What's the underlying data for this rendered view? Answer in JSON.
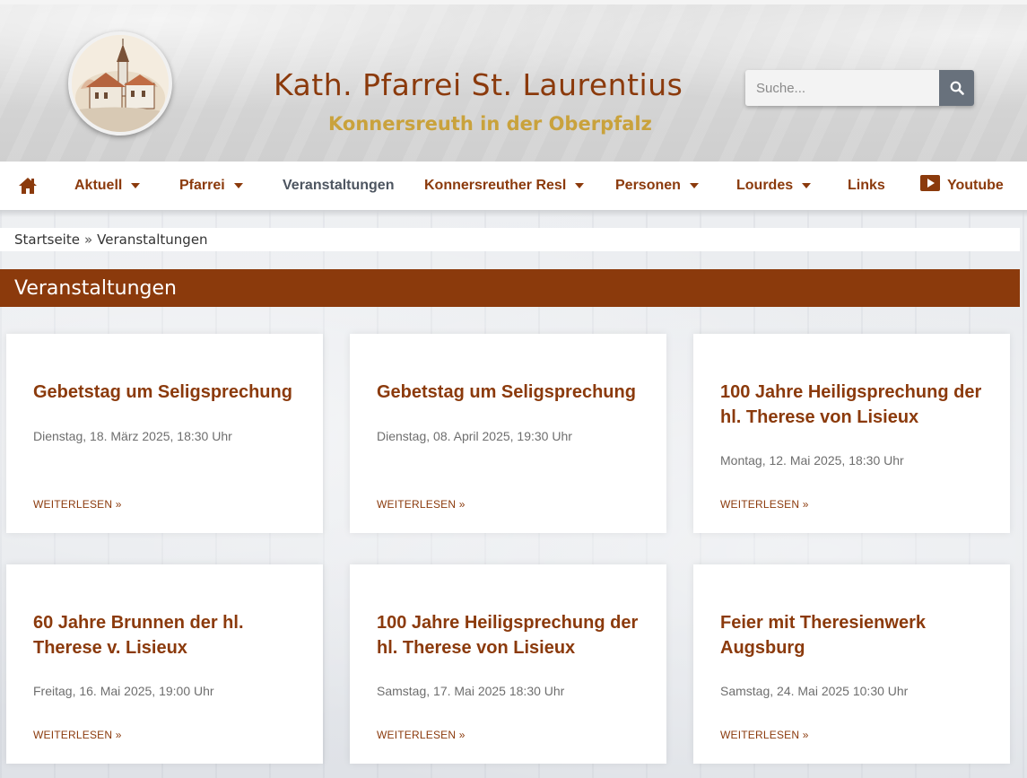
{
  "header": {
    "title": "Kath. Pfarrei St. Laurentius",
    "subtitle": "Konnersreuth in der Oberpfalz",
    "search_placeholder": "Suche..."
  },
  "nav": {
    "items": [
      {
        "label": "Aktuell",
        "dropdown": true
      },
      {
        "label": "Pfarrei",
        "dropdown": true
      },
      {
        "label": "Veranstaltungen",
        "dropdown": false,
        "active": true
      },
      {
        "label": "Konnersreuther Resl",
        "dropdown": true
      },
      {
        "label": "Personen",
        "dropdown": true
      },
      {
        "label": "Lourdes",
        "dropdown": true
      },
      {
        "label": "Links",
        "dropdown": false
      },
      {
        "label": "Youtube",
        "dropdown": false,
        "icon": "youtube-icon"
      }
    ],
    "home_icon": "home-icon"
  },
  "breadcrumb": {
    "home": "Startseite",
    "separator": "»",
    "current": "Veranstaltungen"
  },
  "page_title": "Veranstaltungen",
  "events": [
    {
      "title": "Gebetstag um Seligsprechung",
      "date": "Dienstag, 18. März 2025, 18:30 Uhr",
      "more": "WEITERLESEN »"
    },
    {
      "title": "Gebetstag um Seligsprechung",
      "date": "Dienstag, 08. April 2025, 19:30 Uhr",
      "more": "WEITERLESEN »"
    },
    {
      "title": "100 Jahre Heiligsprechung der hl. Therese von Lisieux",
      "date": "Montag, 12. Mai 2025, 18:30 Uhr",
      "more": "WEITERLESEN »"
    },
    {
      "title": "60 Jahre Brunnen der hl. Therese v. Lisieux",
      "date": "Freitag, 16. Mai 2025, 19:00 Uhr",
      "more": "WEITERLESEN »"
    },
    {
      "title": "100 Jahre Heiligsprechung der hl. Therese von Lisieux",
      "date": "Samstag, 17. Mai 2025 18:30 Uhr",
      "more": "WEITERLESEN »"
    },
    {
      "title": "Feier mit Theresienwerk Augsburg",
      "date": "Samstag, 24. Mai 2025 10:30 Uhr",
      "more": "WEITERLESEN »"
    }
  ],
  "colors": {
    "brand": "#8b3a0c",
    "gold": "#c9a23c",
    "search_button": "#68717c"
  }
}
